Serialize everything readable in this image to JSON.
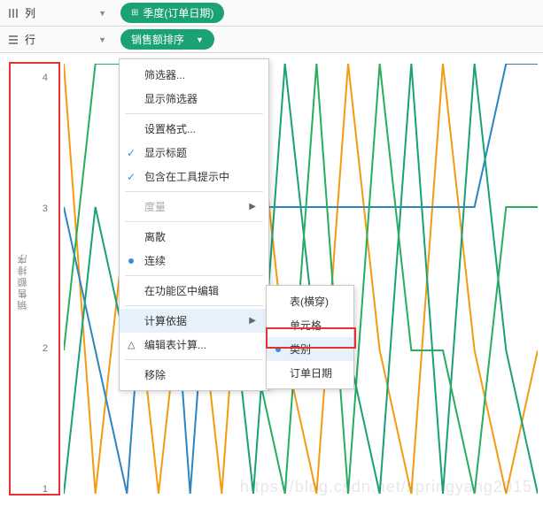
{
  "shelves": {
    "columns_label": "列",
    "rows_label": "行",
    "columns_pill": "季度(订单日期)",
    "rows_pill": "销售额排序"
  },
  "axis": {
    "title": "销售额排序",
    "ticks": [
      "4",
      "3",
      "2",
      "1"
    ]
  },
  "menu": {
    "filter": "筛选器...",
    "show_filter": "显示筛选器",
    "format": "设置格式...",
    "show_header": "显示标题",
    "include_tooltip": "包含在工具提示中",
    "measure": "度量",
    "discrete": "离散",
    "continuous": "连续",
    "edit_in_shelf": "在功能区中编辑",
    "compute_using": "计算依据",
    "edit_table_calc": "编辑表计算...",
    "remove": "移除"
  },
  "submenu": {
    "table_across": "表(横穿)",
    "cell": "单元格",
    "category": "类别",
    "order_date": "订单日期"
  },
  "watermark": "https://blog.csdn.net/springyang2015",
  "chart_data": {
    "type": "line",
    "title": "",
    "xlabel": "",
    "ylabel": "销售额排序",
    "ylim": [
      1,
      4
    ],
    "x": [
      0,
      1,
      2,
      3,
      4,
      5,
      6,
      7,
      8,
      9,
      10,
      11,
      12,
      13,
      14,
      15
    ],
    "series": [
      {
        "name": "orange",
        "color": "#f39c12",
        "values": [
          4,
          1,
          3,
          1,
          3,
          1,
          4,
          2,
          1,
          4,
          2,
          1,
          4,
          2,
          1,
          2
        ]
      },
      {
        "name": "blue",
        "color": "#2e86c1",
        "values": [
          3,
          2,
          1,
          4,
          1,
          4,
          3,
          3,
          3,
          3,
          3,
          3,
          3,
          3,
          4,
          4
        ]
      },
      {
        "name": "teal",
        "color": "#1ba176",
        "values": [
          1,
          3,
          2,
          2,
          2,
          3,
          1,
          4,
          2,
          2,
          1,
          4,
          1,
          4,
          2,
          1
        ]
      },
      {
        "name": "green",
        "color": "#27ae60",
        "values": [
          2,
          4,
          4,
          3,
          4,
          2,
          2,
          1,
          4,
          1,
          4,
          2,
          2,
          1,
          3,
          3
        ]
      }
    ]
  }
}
